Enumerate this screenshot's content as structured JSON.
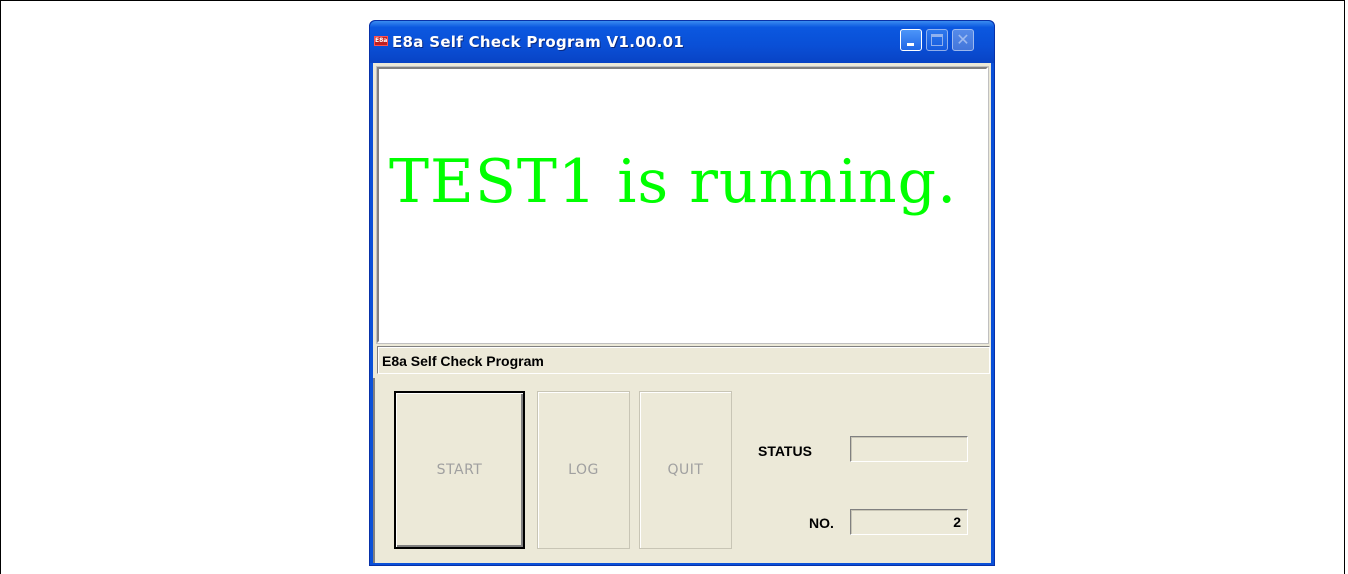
{
  "window": {
    "title": "E8a Self Check Program V1.00.01",
    "icon": "app-icon",
    "title_controls": [
      "minimize-icon",
      "maximize-icon",
      "close-icon"
    ]
  },
  "display": {
    "message": "TEST1 is running.",
    "message_color": "#00ff00"
  },
  "statusbar": {
    "text": "E8a Self Check Program"
  },
  "buttons": {
    "start": "START",
    "log": "LOG",
    "quit": "QUIT"
  },
  "status_panel": {
    "status_label": "STATUS",
    "status_value": "",
    "no_label": "NO.",
    "no_value": "2"
  },
  "colors": {
    "titlebar": "#0a50d8",
    "window_bg": "#ece9d8",
    "disabled_text": "#a0a0a0"
  }
}
